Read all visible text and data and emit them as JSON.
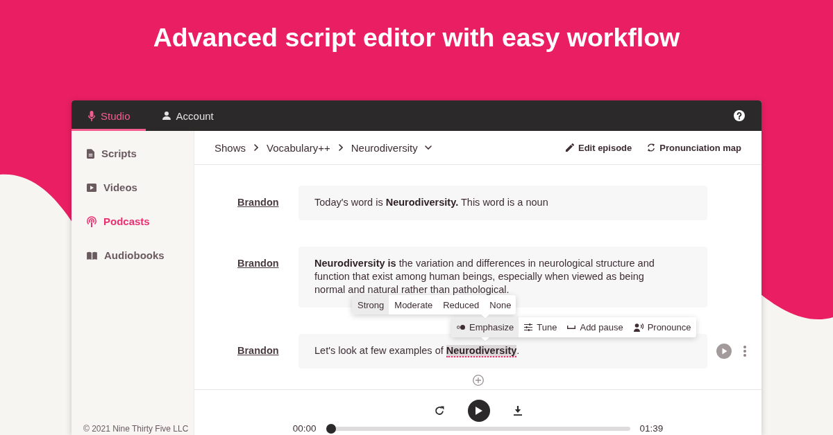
{
  "headline": "Advanced script editor with easy workflow",
  "top_nav": {
    "tabs": [
      {
        "label": "Studio",
        "selected": true
      },
      {
        "label": "Account",
        "selected": false
      }
    ]
  },
  "sidebar": {
    "items": [
      {
        "label": "Scripts",
        "selected": false
      },
      {
        "label": "Videos",
        "selected": false
      },
      {
        "label": "Podcasts",
        "selected": true
      },
      {
        "label": "Audiobooks",
        "selected": false
      }
    ],
    "footer": "© 2021 Nine Thirty Five LLC"
  },
  "breadcrumb": [
    "Shows",
    "Vocabulary++",
    "Neurodiversity"
  ],
  "episode_actions": [
    "Edit episode",
    "Pronunciation map"
  ],
  "script": [
    {
      "speaker": "Brandon",
      "text": "Today's word is **Neurodiversity.** This word is a noun",
      "active": false
    },
    {
      "speaker": "Brandon",
      "text": "**Neurodiversity is** the variation and differences in neurological structure and function that exist among human beings, especially when viewed as being normal and natural rather than pathological.",
      "active": false
    },
    {
      "speaker": "Brandon",
      "text": "Let's look at few examples of **Neurodiversity**.",
      "active": true
    }
  ],
  "annotation_toolbar": {
    "items": [
      {
        "label": "Emphasize",
        "selected": true
      },
      {
        "label": "Tune",
        "selected": false
      },
      {
        "label": "Add pause",
        "selected": false
      },
      {
        "label": "Pronounce",
        "selected": false
      }
    ]
  },
  "emphasis_levels": {
    "items": [
      {
        "label": "Strong",
        "selected": true
      },
      {
        "label": "Moderate",
        "selected": false
      },
      {
        "label": "Reduced",
        "selected": false
      },
      {
        "label": "None",
        "selected": false
      }
    ]
  },
  "player": {
    "current_time": "00:00",
    "duration": "01:39",
    "level": 0
  }
}
